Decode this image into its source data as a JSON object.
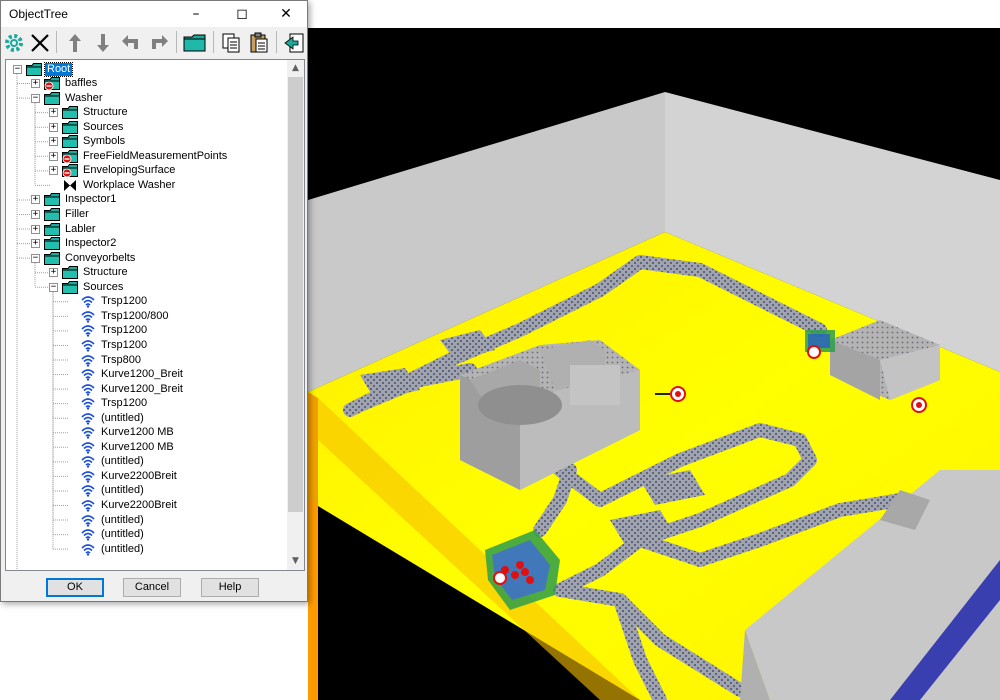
{
  "window": {
    "title": "ObjectTree"
  },
  "toolbar": {
    "icons": [
      "settings-gear-icon",
      "delete-x-icon",
      "move-up-icon",
      "move-down-icon",
      "undo-icon",
      "redo-icon",
      "folder-icon",
      "copy-icon",
      "paste-icon",
      "export-icon"
    ]
  },
  "tree": {
    "items": [
      {
        "label": "Root",
        "level": 0,
        "exp": "minus",
        "icon": "folder",
        "selected": true
      },
      {
        "label": "baffles",
        "level": 1,
        "exp": "plus",
        "icon": "folder-red"
      },
      {
        "label": "Washer",
        "level": 1,
        "exp": "minus",
        "icon": "folder"
      },
      {
        "label": "Structure",
        "level": 2,
        "exp": "plus",
        "icon": "folder"
      },
      {
        "label": "Sources",
        "level": 2,
        "exp": "plus",
        "icon": "folder"
      },
      {
        "label": "Symbols",
        "level": 2,
        "exp": "plus",
        "icon": "folder"
      },
      {
        "label": "FreeFieldMeasurementPoints",
        "level": 2,
        "exp": "plus",
        "icon": "folder-red"
      },
      {
        "label": "EnvelopingSurface",
        "level": 2,
        "exp": "plus",
        "icon": "folder-red"
      },
      {
        "label": "Workplace Washer",
        "level": 2,
        "exp": "none",
        "icon": "bowtie"
      },
      {
        "label": "Inspector1",
        "level": 1,
        "exp": "plus",
        "icon": "folder"
      },
      {
        "label": "Filler",
        "level": 1,
        "exp": "plus",
        "icon": "folder"
      },
      {
        "label": "Labler",
        "level": 1,
        "exp": "plus",
        "icon": "folder"
      },
      {
        "label": "Inspector2",
        "level": 1,
        "exp": "plus",
        "icon": "folder"
      },
      {
        "label": "Conveyorbelts",
        "level": 1,
        "exp": "minus",
        "icon": "folder"
      },
      {
        "label": "Structure",
        "level": 2,
        "exp": "plus",
        "icon": "folder"
      },
      {
        "label": "Sources",
        "level": 2,
        "exp": "minus",
        "icon": "folder"
      },
      {
        "label": "Trsp1200",
        "level": 3,
        "exp": "none",
        "icon": "wave"
      },
      {
        "label": "Trsp1200/800",
        "level": 3,
        "exp": "none",
        "icon": "wave"
      },
      {
        "label": "Trsp1200",
        "level": 3,
        "exp": "none",
        "icon": "wave"
      },
      {
        "label": "Trsp1200",
        "level": 3,
        "exp": "none",
        "icon": "wave"
      },
      {
        "label": "Trsp800",
        "level": 3,
        "exp": "none",
        "icon": "wave"
      },
      {
        "label": "Kurve1200_Breit",
        "level": 3,
        "exp": "none",
        "icon": "wave"
      },
      {
        "label": "Kurve1200_Breit",
        "level": 3,
        "exp": "none",
        "icon": "wave"
      },
      {
        "label": "Trsp1200",
        "level": 3,
        "exp": "none",
        "icon": "wave"
      },
      {
        "label": "(untitled)",
        "level": 3,
        "exp": "none",
        "icon": "wave"
      },
      {
        "label": "Kurve1200 MB",
        "level": 3,
        "exp": "none",
        "icon": "wave"
      },
      {
        "label": "Kurve1200 MB",
        "level": 3,
        "exp": "none",
        "icon": "wave"
      },
      {
        "label": "(untitled)",
        "level": 3,
        "exp": "none",
        "icon": "wave"
      },
      {
        "label": "Kurve2200Breit",
        "level": 3,
        "exp": "none",
        "icon": "wave"
      },
      {
        "label": "(untitled)",
        "level": 3,
        "exp": "none",
        "icon": "wave"
      },
      {
        "label": "Kurve2200Breit",
        "level": 3,
        "exp": "none",
        "icon": "wave"
      },
      {
        "label": "(untitled)",
        "level": 3,
        "exp": "none",
        "icon": "wave"
      },
      {
        "label": "(untitled)",
        "level": 3,
        "exp": "none",
        "icon": "wave"
      },
      {
        "label": "(untitled)",
        "level": 3,
        "exp": "none",
        "icon": "wave"
      }
    ]
  },
  "buttons": {
    "ok": "OK",
    "cancel": "Cancel",
    "help": "Help"
  },
  "colors": {
    "folder": "#1aa99a",
    "floor": "#ffff00",
    "wall": "#c8c8c8",
    "selection": "#0078d7",
    "source_wave": "#1a4fd6",
    "marker_red": "#e01010"
  }
}
